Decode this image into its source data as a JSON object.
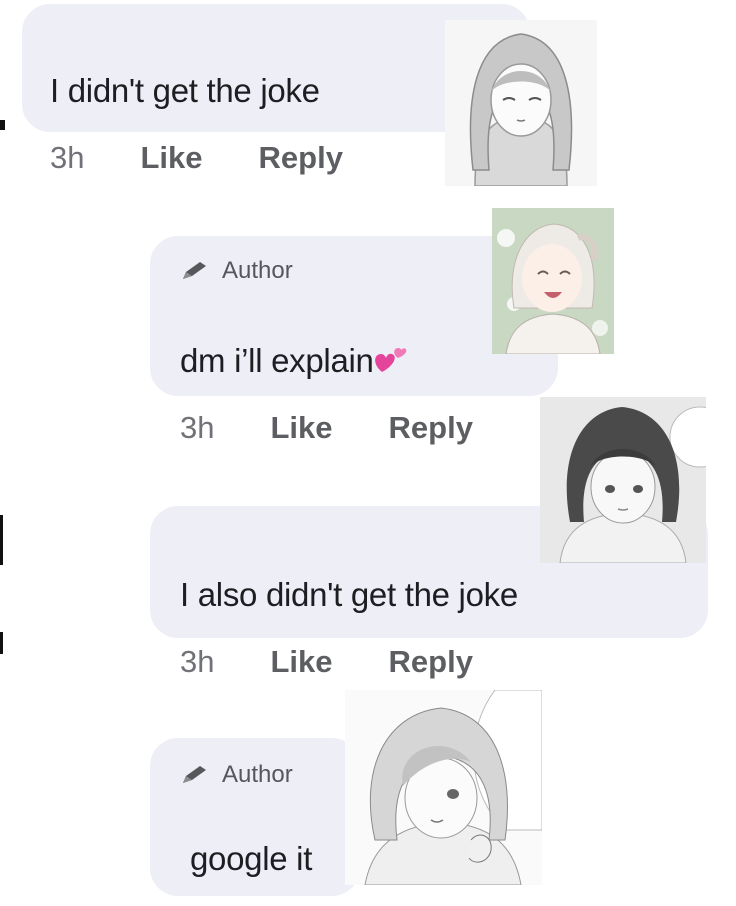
{
  "comments": [
    {
      "text": "I didn't get the joke",
      "time": "3h",
      "like": "Like",
      "reply": "Reply"
    },
    {
      "author": "Author",
      "text": "dm i’ll explain",
      "time": "3h",
      "like": "Like",
      "reply": "Reply"
    },
    {
      "text": "I also didn't get the joke",
      "time": "3h",
      "like": "Like",
      "reply": "Reply"
    },
    {
      "author": "Author",
      "text": "google it"
    }
  ],
  "icons": {
    "author_badge": "pencil-icon",
    "emoji": "two-hearts-emoji"
  },
  "colors": {
    "bubble": "#eeeef6",
    "meta_text": "#65676b",
    "heart": "#e4459a"
  }
}
